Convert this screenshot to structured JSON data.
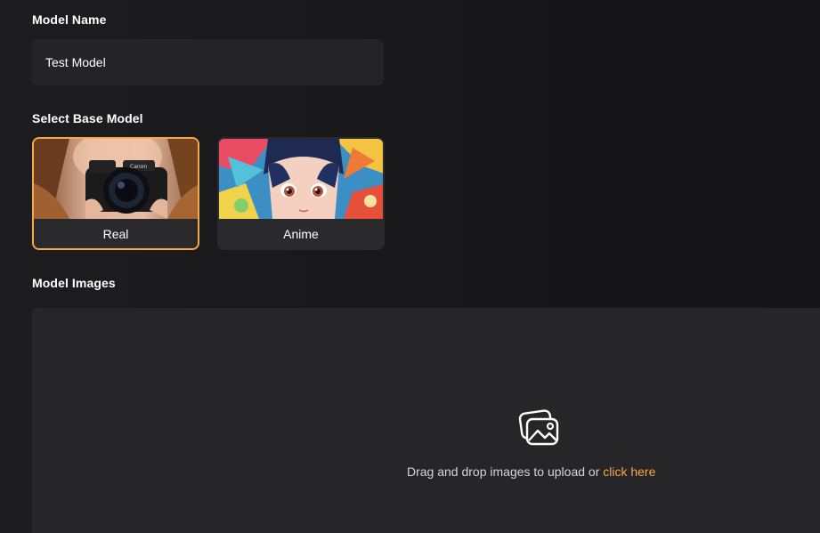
{
  "model_name": {
    "label": "Model Name",
    "value": "Test Model"
  },
  "base_model": {
    "label": "Select Base Model",
    "options": [
      {
        "label": "Real",
        "selected": true
      },
      {
        "label": "Anime",
        "selected": false
      }
    ]
  },
  "model_images": {
    "label": "Model Images",
    "dropzone_text": "Drag and drop images to upload or",
    "link_text": "click here",
    "icon": "images-icon"
  },
  "colors": {
    "accent": "#f5a94a",
    "background": "#19191b",
    "input_bg": "#242427",
    "dropzone_bg": "#262628"
  }
}
